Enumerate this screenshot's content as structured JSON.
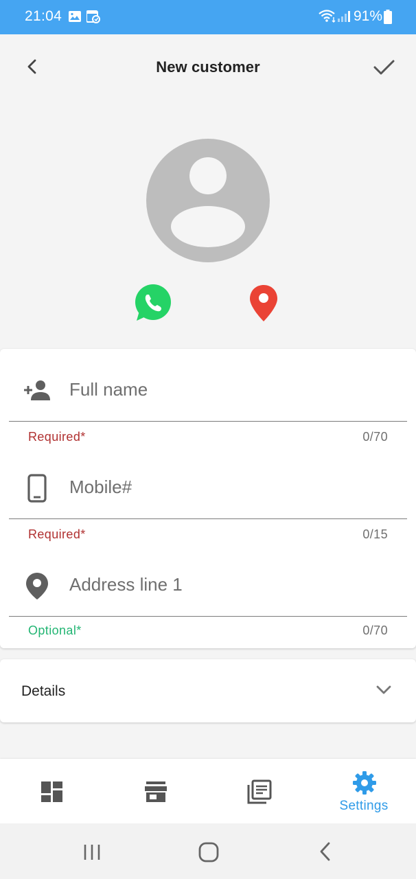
{
  "status_bar": {
    "time": "21:04",
    "battery": "91%"
  },
  "header": {
    "title": "New customer"
  },
  "fields": [
    {
      "label": "Full name",
      "helper": "Required*",
      "counter": "0/70",
      "helper_type": "required"
    },
    {
      "label": "Mobile#",
      "helper": "Required*",
      "counter": "0/15",
      "helper_type": "required"
    },
    {
      "label": "Address line 1",
      "helper": "Optional*",
      "counter": "0/70",
      "helper_type": "optional"
    }
  ],
  "details": {
    "label": "Details"
  },
  "bottom_nav": {
    "settings_label": "Settings",
    "active_item": "settings"
  },
  "colors": {
    "status_bar": "#45a5f2",
    "accent": "#2f9be8",
    "required": "#b03030",
    "optional": "#22b573",
    "whatsapp": "#25d366",
    "location": "#ea4335",
    "avatar": "#bdbdbd"
  },
  "icons": {
    "status": [
      "gallery-icon",
      "calendar-icon",
      "wifi-icon",
      "signal-icon",
      "battery-icon"
    ],
    "header": [
      "back-arrow-icon",
      "check-icon"
    ],
    "actions": [
      "whatsapp-icon",
      "location-pin-icon"
    ],
    "fields": [
      "person-add-icon",
      "smartphone-icon",
      "place-icon"
    ],
    "nav": [
      "dashboard-icon",
      "store-icon",
      "library-books-icon",
      "gear-icon"
    ],
    "system": [
      "recent-apps-icon",
      "home-icon",
      "system-back-icon"
    ]
  }
}
